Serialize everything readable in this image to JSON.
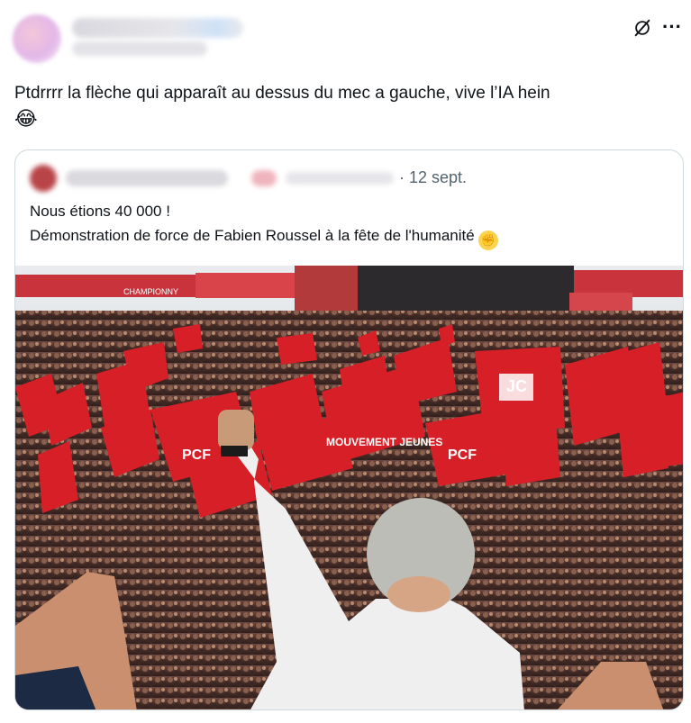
{
  "tweet": {
    "text": "Ptdrrrr la flèche qui apparaît au dessus du mec a gauche, vive l’IA hein",
    "emoji": "😂"
  },
  "icons": {
    "grok": "grok-icon",
    "more": "more-icon",
    "fist": "raised-fist-emoji"
  },
  "more_label": "···",
  "quoted_tweet": {
    "date": "· 12 sept.",
    "line1": "Nous étions 40 000 !",
    "line2": "Démonstration de force de Fabien Roussel à la fête de l'humanité",
    "image_texts": [
      "CHAMPIONNY",
      "PCF",
      "MOUVEMENT JEUNES",
      "JC"
    ]
  },
  "colors": {
    "text": "#0f1419",
    "muted": "#536471",
    "border": "#cfd9de",
    "flag_red": "#d61f26"
  }
}
